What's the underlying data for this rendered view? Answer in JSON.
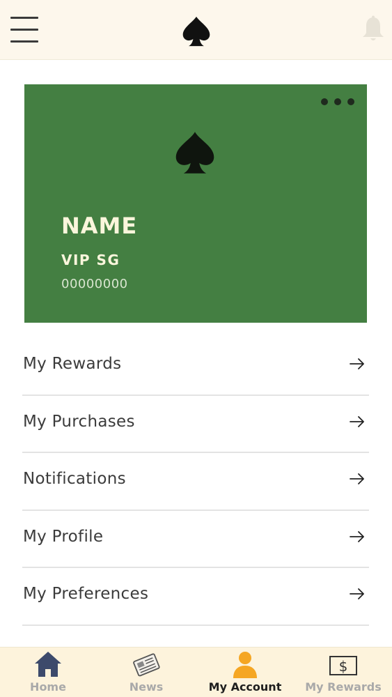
{
  "header": {
    "menu_icon": "hamburger-menu-icon",
    "logo_icon": "spade-logo-icon",
    "notification_icon": "bell-icon"
  },
  "card": {
    "name": "NAME",
    "tier": "VIP SG",
    "number": "00000000",
    "more_icon": "more-dots-icon",
    "background_color": "#447f42"
  },
  "menu": {
    "items": [
      {
        "label": "My Rewards",
        "icon": "arrow-right-icon"
      },
      {
        "label": "My Purchases",
        "icon": "arrow-right-icon"
      },
      {
        "label": "Notifications",
        "icon": "arrow-right-icon"
      },
      {
        "label": "My Profile",
        "icon": "arrow-right-icon"
      },
      {
        "label": "My Preferences",
        "icon": "arrow-right-icon"
      }
    ]
  },
  "tabbar": {
    "active": "My Account",
    "accent_color": "#f5a623",
    "tabs": [
      {
        "label": "Home",
        "icon": "home-icon"
      },
      {
        "label": "News",
        "icon": "newspaper-icon"
      },
      {
        "label": "My Account",
        "icon": "user-icon"
      },
      {
        "label": "My Rewards",
        "icon": "dollar-bill-icon"
      }
    ]
  }
}
